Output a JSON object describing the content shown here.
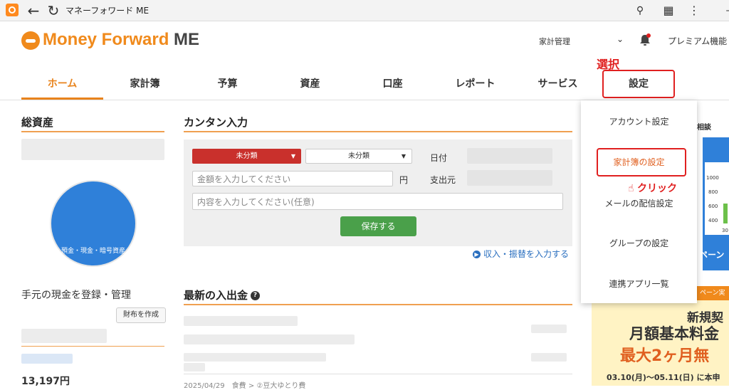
{
  "browser": {
    "tab_title": "マネーフォワード ME",
    "icons": {
      "back": "back-arrow-icon",
      "reload": "reload-icon",
      "zoom": "zoom-icon",
      "extensions": "puzzle-icon",
      "menu": "kebab-menu-icon"
    }
  },
  "header": {
    "logo_text": "Money Forward",
    "logo_me": "ME",
    "household": "家計管理",
    "premium": "プレミアム機能"
  },
  "nav": {
    "items": [
      "ホーム",
      "家計簿",
      "予算",
      "資産",
      "口座",
      "レポート",
      "サービス",
      "設定"
    ],
    "active": "ホーム"
  },
  "annotations": {
    "select": "選択",
    "click": "クリック"
  },
  "left": {
    "total_assets_title": "総資産",
    "pie_label": "預金・現金・暗号資産",
    "cash_register": "手元の現金を登録・管理",
    "create_wallet": "財布を作成",
    "amount": "13,197円"
  },
  "quick_input": {
    "title": "カンタン入力",
    "category_main": "未分類",
    "category_sub": "未分類",
    "date_label": "日付",
    "amount_placeholder": "金額を入力してください",
    "yen": "円",
    "payer_label": "支出元",
    "memo_placeholder": "内容を入力してください(任意)",
    "save": "保存する",
    "income_link": "収入・振替を入力する"
  },
  "recent": {
    "title": "最新の入出金",
    "last_line": "2025/04/29　食費 > ②豆大ゆとり費"
  },
  "dropdown": {
    "items": [
      "アカウント設定",
      "家計簿の設定",
      "メールの配信設定",
      "グループの設定",
      "連携アプリ一覧"
    ]
  },
  "right": {
    "consult": "相談",
    "ticks": [
      "1000",
      "800",
      "600",
      "400",
      "200"
    ],
    "tick_tail": "30",
    "campaign": "ペーン",
    "banner_top": "ペーン実",
    "banner_line1": "新規契",
    "banner_line2": "月額基本料金",
    "banner_line3": "最大2ヶ月無",
    "banner_line4": "03.10(月)〜05.11(日) に本申"
  },
  "colors": {
    "brand_orange": "#f08a1c",
    "annotation_red": "#e02020",
    "save_green": "#4aa04a",
    "category_red": "#c9302c",
    "pie_blue": "#2f80d9"
  }
}
